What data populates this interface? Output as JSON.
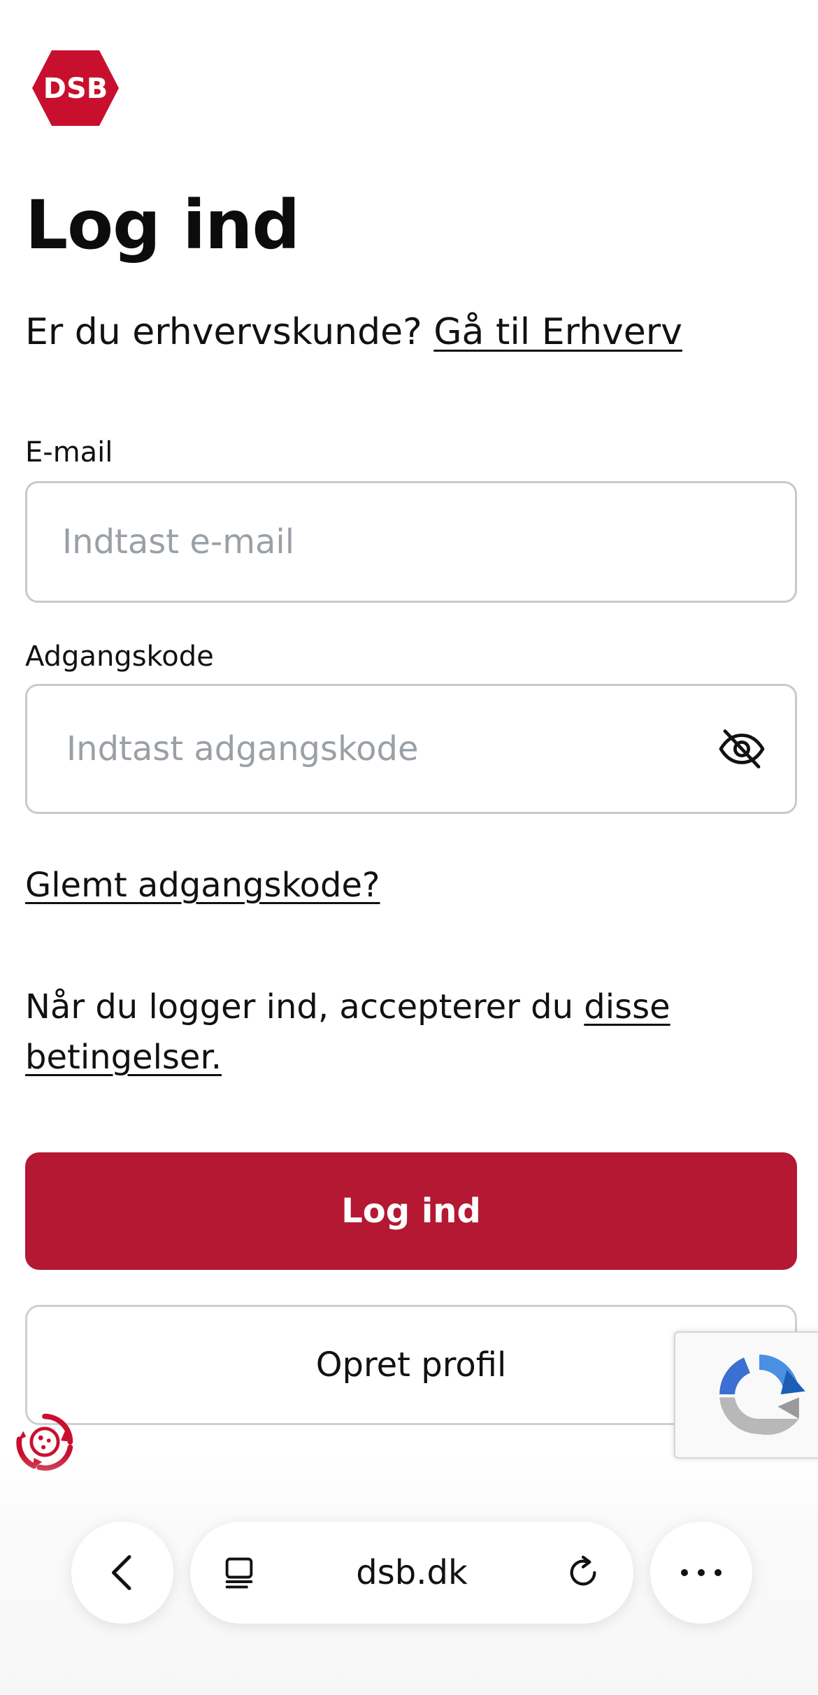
{
  "brand": {
    "logo_text": "DSB",
    "accent_color": "#b41832"
  },
  "page": {
    "title": "Log ind"
  },
  "business": {
    "question": "Er du erhvervskunde?",
    "link": "Gå til Erhverv"
  },
  "email": {
    "label": "E-mail",
    "placeholder": "Indtast e-mail"
  },
  "password": {
    "label": "Adgangskode",
    "placeholder": "Indtast adgangskode",
    "toggle_icon": "eye-slash-icon"
  },
  "forgot_link": "Glemt adgangskode?",
  "terms": {
    "text": "Når du logger ind, accepterer du",
    "link": "disse betingelser."
  },
  "buttons": {
    "login": "Log ind",
    "create_profile": "Opret profil"
  },
  "browser": {
    "url": "dsb.dk",
    "icons": [
      "back-icon",
      "tabs-icon",
      "reload-icon",
      "more-icon"
    ]
  }
}
